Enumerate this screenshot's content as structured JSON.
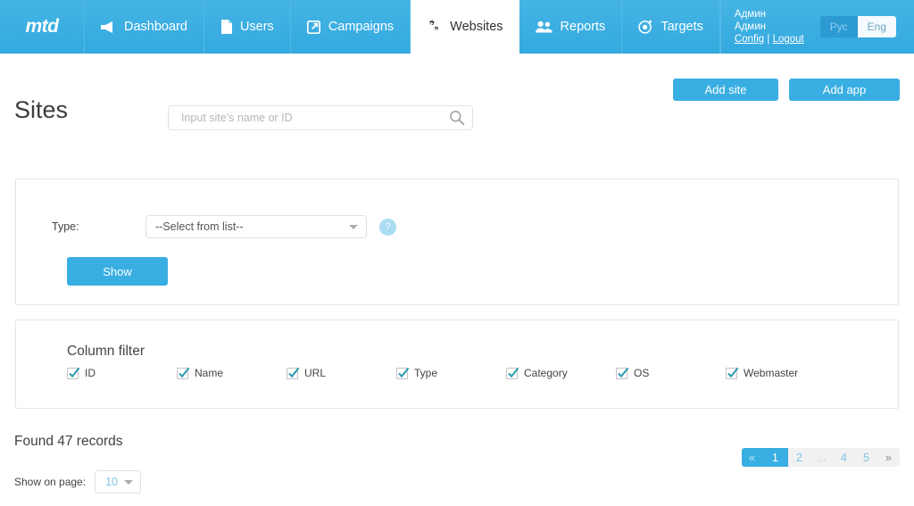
{
  "brand": {
    "logo": "mtd"
  },
  "nav": {
    "items": [
      {
        "label": "Dashboard",
        "icon": "megaphone-icon",
        "active": false
      },
      {
        "label": "Users",
        "icon": "document-icon",
        "active": false
      },
      {
        "label": "Campaigns",
        "icon": "external-link-icon",
        "active": false
      },
      {
        "label": "Websites",
        "icon": "gears-icon",
        "active": true
      },
      {
        "label": "Reports",
        "icon": "people-icon",
        "active": false
      },
      {
        "label": "Targets",
        "icon": "target-icon",
        "active": false
      }
    ]
  },
  "user": {
    "line1": "Админ",
    "line2": "Админ",
    "config_link": "Config",
    "separator": "|",
    "logout_link": "Logout",
    "lang_rus": "Рус",
    "lang_eng": "Eng",
    "lang_selected": "Eng"
  },
  "header": {
    "title": "Sites",
    "search_placeholder": "Input site's name or ID",
    "search_value": "",
    "search_icon": "search-icon",
    "add_site_label": "Add site",
    "add_app_label": "Add app"
  },
  "filter_panel": {
    "type_label": "Type:",
    "type_value": "--Select from list--",
    "help_label": "?",
    "show_label": "Show"
  },
  "column_filter": {
    "title": "Column filter",
    "columns": [
      {
        "label": "ID",
        "checked": true
      },
      {
        "label": "Name",
        "checked": true
      },
      {
        "label": "URL",
        "checked": true
      },
      {
        "label": "Type",
        "checked": true
      },
      {
        "label": "Category",
        "checked": true
      },
      {
        "label": "OS",
        "checked": true
      },
      {
        "label": "Webmaster",
        "checked": true
      }
    ]
  },
  "footer": {
    "found_text": "Found 47 records",
    "show_on_page_label": "Show on page:",
    "show_on_page_value": "10",
    "pagination": [
      {
        "label": "«",
        "kind": "prev"
      },
      {
        "label": "1",
        "kind": "active"
      },
      {
        "label": "2",
        "kind": "page"
      },
      {
        "label": "...",
        "kind": "dots"
      },
      {
        "label": "4",
        "kind": "page"
      },
      {
        "label": "5",
        "kind": "page"
      },
      {
        "label": "»",
        "kind": "next"
      }
    ]
  },
  "colors": {
    "brand_blue": "#39aee2",
    "nav_blue": "#37aee0",
    "check_teal": "#2a9ab0",
    "panel_border": "#e6e6e6"
  }
}
